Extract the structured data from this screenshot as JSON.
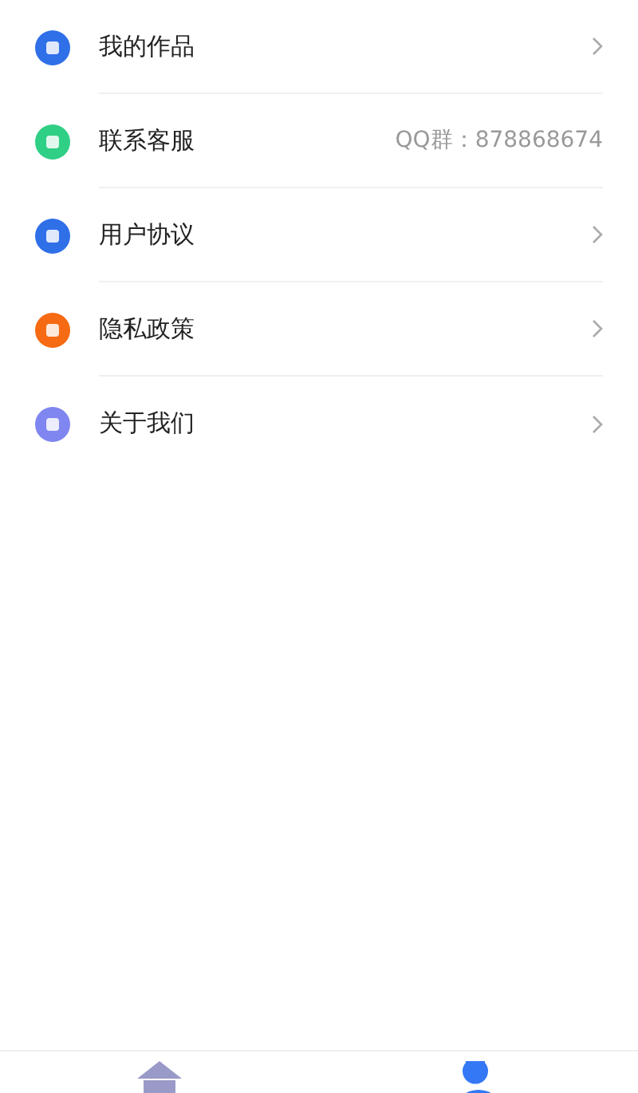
{
  "menu": [
    {
      "label": "我的作品",
      "kind": "link",
      "color": "#2f6fe8"
    },
    {
      "label": "联系客服",
      "kind": "info",
      "color": "#2fcf85",
      "value": "QQ群：878868674"
    },
    {
      "label": "用户协议",
      "kind": "link",
      "color": "#2f6fe8"
    },
    {
      "label": "隐私政策",
      "kind": "link",
      "color": "#f56a12"
    },
    {
      "label": "关于我们",
      "kind": "link",
      "color": "#7f86f0"
    }
  ],
  "tab_bar": [
    {
      "kind": "home",
      "selected": false
    },
    {
      "kind": "profile",
      "selected": true
    }
  ]
}
